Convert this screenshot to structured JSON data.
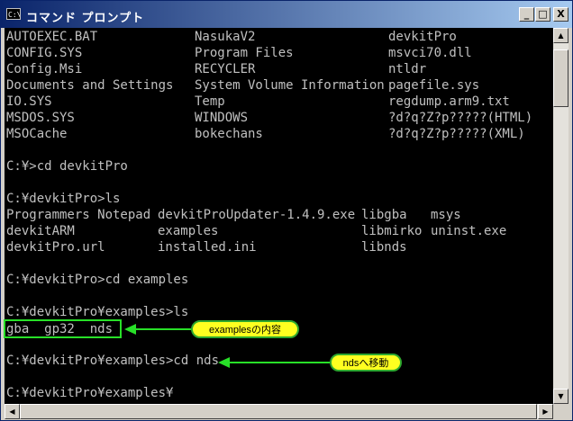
{
  "window": {
    "icon_text": "C:\\",
    "title": "コマンド プロンプト",
    "minimize_label": "_",
    "maximize_label": "□",
    "close_label": "X"
  },
  "console": {
    "dir_rows": [
      [
        "AUTOEXEC.BAT",
        "NasukaV2",
        "devkitPro"
      ],
      [
        "CONFIG.SYS",
        "Program Files",
        "msvci70.dll"
      ],
      [
        "Config.Msi",
        "RECYCLER",
        "ntldr"
      ],
      [
        "Documents and Settings",
        "System Volume Information",
        "pagefile.sys"
      ],
      [
        "IO.SYS",
        "Temp",
        "regdump.arm9.txt"
      ],
      [
        "MSDOS.SYS",
        "WINDOWS",
        "?d?q?Z?p?????(HTML)"
      ],
      [
        "MSOCache",
        "bokechans",
        "?d?q?Z?p?????(XML)"
      ]
    ],
    "cmd1": "C:¥>cd devkitPro",
    "cmd2": "C:¥devkitPro>ls",
    "ls_rows": [
      [
        "Programmers Notepad",
        "devkitProUpdater-1.4.9.exe",
        "libgba",
        "msys"
      ],
      [
        "devkitARM",
        "examples",
        "libmirko",
        "uninst.exe"
      ],
      [
        "devkitPro.url",
        "installed.ini",
        "libnds",
        ""
      ]
    ],
    "cmd3": "C:¥devkitPro>cd examples",
    "cmd4": "C:¥devkitPro¥examples>ls",
    "examples_ls": "gba  gp32  nds",
    "cmd5": "C:¥devkitPro¥examples>cd nds",
    "prompt": "C:¥devkitPro¥examples¥"
  },
  "annotations": {
    "examples_label": "examplesの内容",
    "nds_label": "ndsへ移動"
  },
  "colors": {
    "console_bg": "#000000",
    "console_fg": "#c0c0c0",
    "highlight": "#28e028",
    "bubble_fill": "#ffff20"
  }
}
